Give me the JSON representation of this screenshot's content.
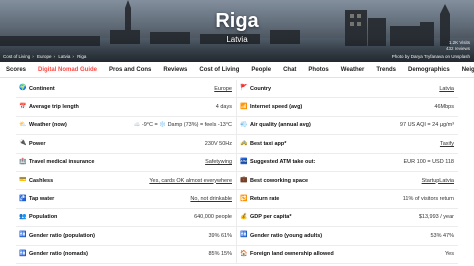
{
  "hero": {
    "city": "Riga",
    "country": "Latvia",
    "breadcrumb": [
      "Cost of Living",
      "Europe",
      "Latvia",
      "Riga"
    ],
    "meta_line1": "1.2K Visits",
    "meta_line2": "432 reviews",
    "photo_credit": "Photo by Darya Tryfanava on Unsplash"
  },
  "tabs": [
    {
      "label": "Scores",
      "active": false
    },
    {
      "label": "Digital Nomad Guide",
      "active": true
    },
    {
      "label": "Pros and Cons",
      "active": false
    },
    {
      "label": "Reviews",
      "active": false
    },
    {
      "label": "Cost of Living",
      "active": false
    },
    {
      "label": "People",
      "active": false
    },
    {
      "label": "Chat",
      "active": false
    },
    {
      "label": "Photos",
      "active": false
    },
    {
      "label": "Weather",
      "active": false
    },
    {
      "label": "Trends",
      "active": false
    },
    {
      "label": "Demographics",
      "active": false
    },
    {
      "label": "Neighborhoods",
      "active": false
    }
  ],
  "rows": [
    {
      "left": {
        "icon": "continent-icon",
        "glyph": "🌍",
        "label": "Continent",
        "value": "Europe",
        "style": "link"
      },
      "right": {
        "icon": "country-icon",
        "glyph": "🚩",
        "label": "Country",
        "value": "Latvia",
        "style": "link"
      }
    },
    {
      "left": {
        "icon": "calendar-icon",
        "glyph": "📅",
        "label": "Average trip length",
        "value": "4 days",
        "style": "plain"
      },
      "right": {
        "icon": "wifi-icon",
        "glyph": "📶",
        "label": "Internet speed (avg)",
        "value": "46Mbps",
        "style": "plain"
      }
    },
    {
      "left": {
        "icon": "weather-icon",
        "glyph": "⛅",
        "label": "Weather (now)",
        "value": "☁️ -9°C = ❄️ Damp (73%) = feels -13°C",
        "style": "plain"
      },
      "right": {
        "icon": "air-quality-icon",
        "glyph": "💨",
        "label": "Air quality (annual avg)",
        "value": "97 US AQI = 24 µg/m³",
        "style": "plain"
      }
    },
    {
      "left": {
        "icon": "power-icon",
        "glyph": "🔌",
        "label": "Power",
        "value": "230V 50Hz",
        "style": "plain"
      },
      "right": {
        "icon": "taxi-icon",
        "glyph": "🚕",
        "label": "Best taxi app*",
        "value": "Taxify",
        "style": "link"
      }
    },
    {
      "left": {
        "icon": "medical-icon",
        "glyph": "🏥",
        "label": "Travel medical insurance",
        "value": "Safetywing",
        "style": "link"
      },
      "right": {
        "icon": "atm-icon",
        "glyph": "🏧",
        "label": "Suggested ATM take out:",
        "value": "EUR 100 = USD 118",
        "style": "plain"
      }
    },
    {
      "left": {
        "icon": "card-icon",
        "glyph": "💳",
        "label": "Cashless",
        "value": "Yes, cards OK almost everywhere",
        "style": "link"
      },
      "right": {
        "icon": "coworking-icon",
        "glyph": "💼",
        "label": "Best coworking space",
        "value": "StartupLatvia",
        "style": "link"
      }
    },
    {
      "left": {
        "icon": "tap-water-icon",
        "glyph": "🚰",
        "label": "Tap water",
        "value": "No, not drinkable",
        "style": "link"
      },
      "right": {
        "icon": "return-rate-icon",
        "glyph": "🔁",
        "label": "Return rate",
        "value": "11% of visitors return",
        "style": "plain"
      }
    },
    {
      "left": {
        "icon": "population-icon",
        "glyph": "👥",
        "label": "Population",
        "value": "640,000 people",
        "style": "plain"
      },
      "right": {
        "icon": "gdp-icon",
        "glyph": "💰",
        "label": "GDP per capita*",
        "value": "$13,993 / year",
        "style": "plain"
      }
    },
    {
      "left": {
        "icon": "gender-population-icon",
        "glyph": "🚻",
        "label": "Gender ratio (population)",
        "value": "39% 61%",
        "style": "plain"
      },
      "right": {
        "icon": "gender-young-icon",
        "glyph": "🚻",
        "label": "Gender ratio (young adults)",
        "value": "53% 47%",
        "style": "plain"
      }
    },
    {
      "left": {
        "icon": "gender-nomads-icon",
        "glyph": "🚻",
        "label": "Gender ratio (nomads)",
        "value": "85% 15%",
        "style": "plain"
      },
      "right": {
        "icon": "land-ownership-icon",
        "glyph": "🏠",
        "label": "Foreign land ownership allowed",
        "value": "Yes",
        "style": "plain"
      }
    }
  ],
  "colors": {
    "accent": "#ff4742",
    "border": "#ececec"
  }
}
